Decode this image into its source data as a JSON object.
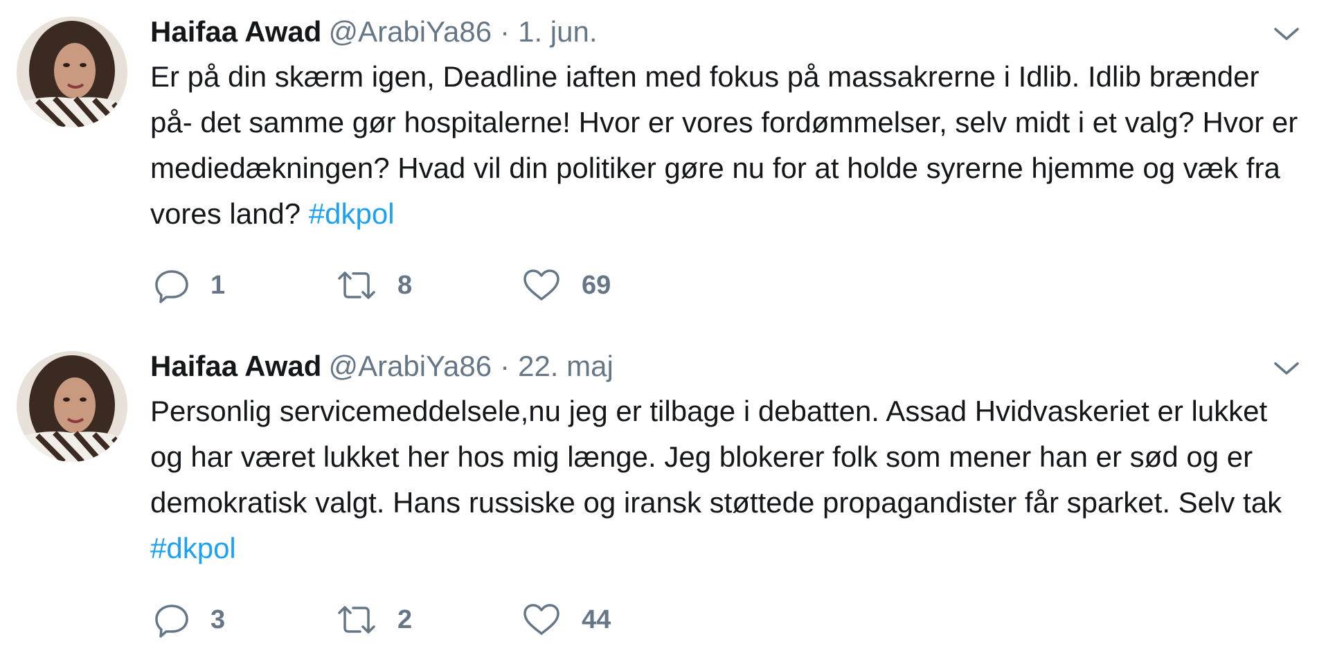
{
  "tweets": [
    {
      "name": "Haifaa Awad",
      "handle": "@ArabiYa86",
      "separator": "·",
      "date": "1. jun.",
      "text": "Er på din skærm igen, Deadline iaften med fokus på massakrerne i Idlib. Idlib brænder på- det samme gør hospitalerne! Hvor er vores fordømmelser, selv midt i et valg? Hvor er mediedækningen? Hvad vil din politiker gøre nu for at holde syrerne hjemme og væk fra vores land?",
      "hashtag": "#dkpol",
      "replies": "1",
      "retweets": "8",
      "likes": "69"
    },
    {
      "name": "Haifaa Awad",
      "handle": "@ArabiYa86",
      "separator": "·",
      "date": "22. maj",
      "text": "Personlig servicemeddelsele,nu jeg er tilbage i debatten. Assad Hvidvaskeriet er lukket og har været lukket her hos mig længe. Jeg blokerer folk som mener han er sød og er demokratisk valgt. Hans russiske og iransk støttede propagandister får sparket. Selv tak",
      "hashtag": "#dkpol",
      "replies": "3",
      "retweets": "2",
      "likes": "44"
    }
  ],
  "icons": {
    "reply": "reply-icon",
    "retweet": "retweet-icon",
    "like": "heart-icon",
    "caret": "chevron-down-icon"
  },
  "colors": {
    "text": "#14171a",
    "secondary": "#657786",
    "link": "#1da1f2"
  }
}
